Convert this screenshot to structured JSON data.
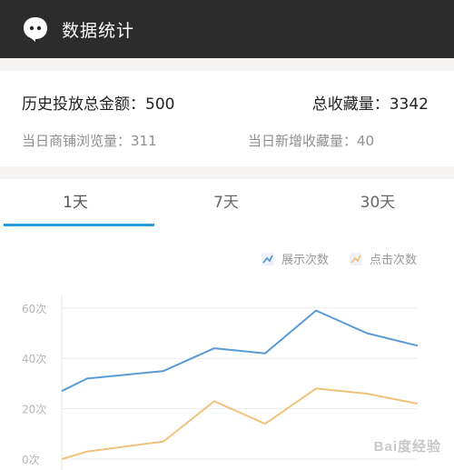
{
  "header": {
    "title": "数据统计",
    "icon": "chat-bubble-icon"
  },
  "stats": {
    "total_spend": "历史投放总金额：500",
    "total_favorites": "总收藏量：3342",
    "shop_views_today": "当日商铺浏览量：311",
    "new_favorites_today": "当日新增收藏量：40"
  },
  "tabs": [
    {
      "label": "1天",
      "active": true
    },
    {
      "label": "7天",
      "active": false
    },
    {
      "label": "30天",
      "active": false
    }
  ],
  "colors": {
    "accent": "#2b9be0",
    "header_bg": "#2c2c2c",
    "series_display": "#5b9bd5",
    "series_click": "#f0c27b"
  },
  "chart_data": {
    "type": "line",
    "x": [
      0,
      1,
      2,
      3,
      4,
      5,
      6,
      7
    ],
    "ylim": [
      0,
      65
    ],
    "yticks": [
      {
        "value": 0,
        "label": "0次"
      },
      {
        "value": 20,
        "label": "20次"
      },
      {
        "value": 40,
        "label": "40次"
      },
      {
        "value": 60,
        "label": "60次"
      }
    ],
    "grid": true,
    "legend_position": "top-right",
    "series": [
      {
        "name": "展示次数",
        "color": "#5b9bd5",
        "x": [
          0,
          0.5,
          2,
          3,
          4,
          5,
          6,
          7
        ],
        "values": [
          27,
          32,
          35,
          44,
          42,
          59,
          50,
          45
        ]
      },
      {
        "name": "点击次数",
        "color": "#f0c27b",
        "x": [
          0,
          0.5,
          2,
          3,
          4,
          5,
          6,
          7
        ],
        "values": [
          0,
          3,
          7,
          23,
          14,
          28,
          26,
          22
        ]
      }
    ]
  },
  "watermark": "Bai度经验"
}
